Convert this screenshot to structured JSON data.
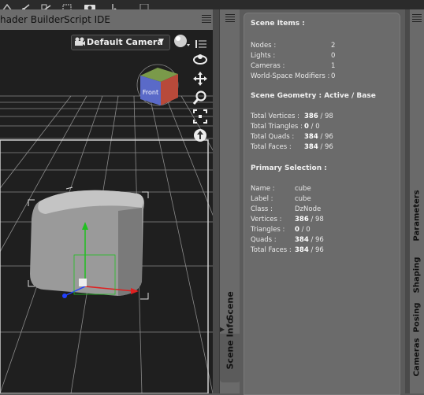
{
  "tabs": {
    "shader_builder": "hader Builder",
    "script_ide": "Script IDE"
  },
  "viewport": {
    "camera": "Default Camera",
    "cube_face_label": "Front"
  },
  "side_tabs": {
    "scene": "Scene",
    "scene_info": "Scene Info"
  },
  "right_tabs": {
    "parameters": "Parameters",
    "shaping": "Shaping",
    "posing": "Posing",
    "cameras": "Cameras"
  },
  "scene_items": {
    "title": "Scene Items :",
    "rows": [
      {
        "label": "Nodes :",
        "value": "2"
      },
      {
        "label": "Lights :",
        "value": "0"
      },
      {
        "label": "Cameras :",
        "value": "1"
      },
      {
        "label": "World-Space Modifiers :",
        "value": "0"
      }
    ]
  },
  "scene_geometry": {
    "title": "Scene Geometry : Active / Base",
    "rows": [
      {
        "label": "Total Vertices :",
        "active": "386",
        "base": " / 98"
      },
      {
        "label": "Total Triangles :",
        "active": "0",
        "base": " / 0"
      },
      {
        "label": "Total Quads :",
        "active": "384",
        "base": " / 96"
      },
      {
        "label": "Total Faces :",
        "active": "384",
        "base": " / 96"
      }
    ]
  },
  "primary_selection": {
    "title": "Primary Selection :",
    "rows": [
      {
        "label": "Name :",
        "value": "cube",
        "base": ""
      },
      {
        "label": "Label :",
        "value": "cube",
        "base": ""
      },
      {
        "label": "Class :",
        "value": "DzNode",
        "base": ""
      },
      {
        "label": "Vertices :",
        "value": "386",
        "base": " / 98"
      },
      {
        "label": "Triangles :",
        "value": "0",
        "base": " / 0"
      },
      {
        "label": "Quads :",
        "value": "384",
        "base": " / 96"
      },
      {
        "label": "Total Faces :",
        "value": "384",
        "base": " / 96"
      }
    ]
  },
  "colors": {
    "panel_bg": "#6b6b6b",
    "viewport_bg": "#1f1f1f",
    "axis_x": "#e02020",
    "axis_y": "#20c020",
    "axis_z": "#2040ff"
  }
}
